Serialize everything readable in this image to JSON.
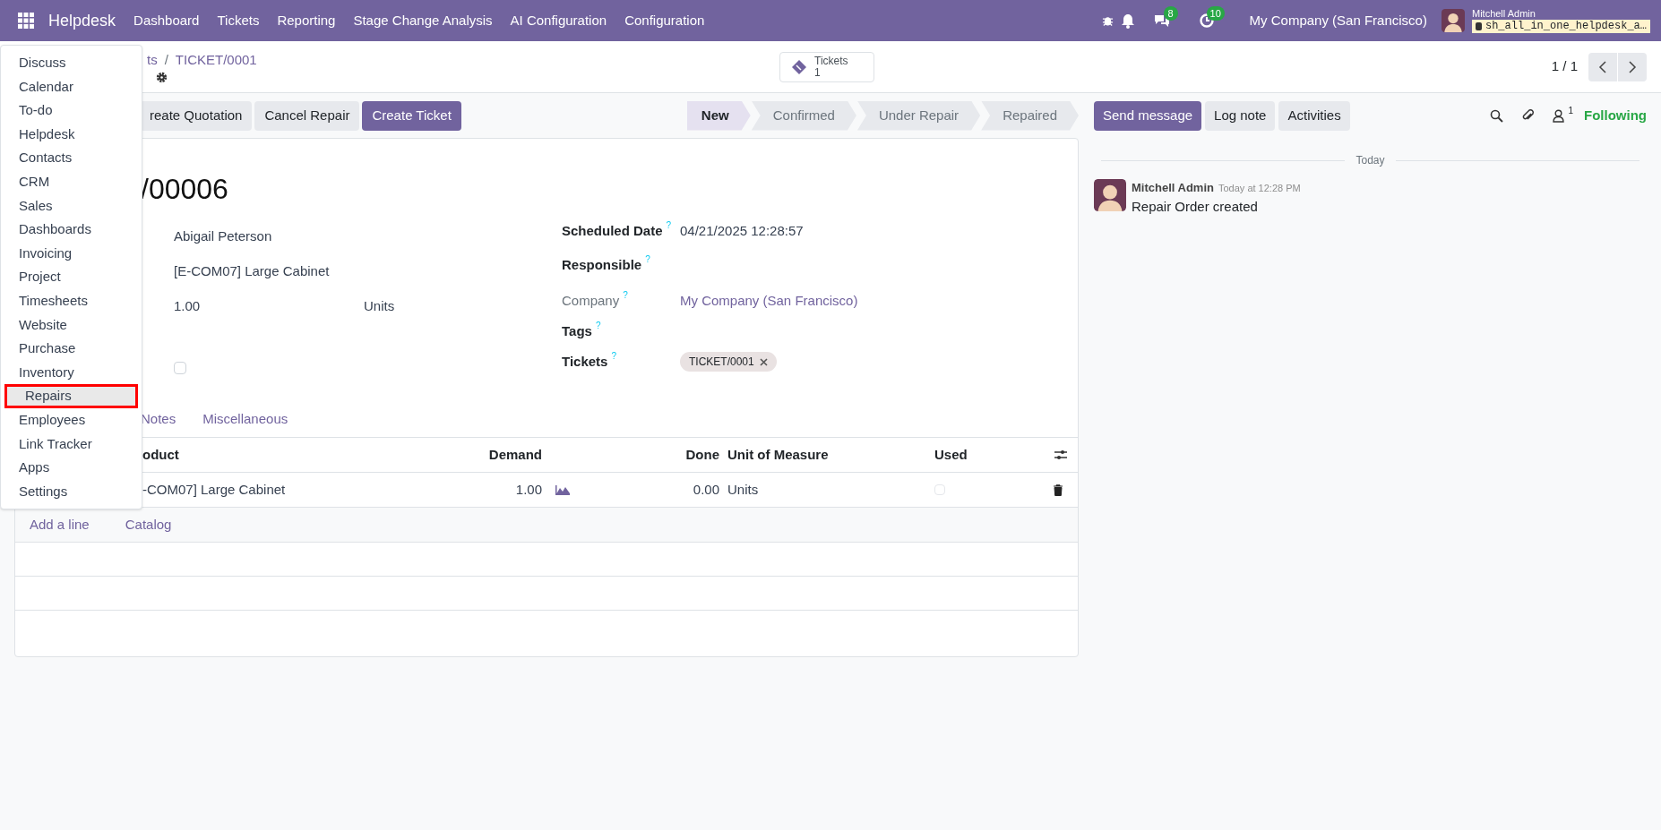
{
  "navbar": {
    "app_name": "Helpdesk",
    "menu": [
      "Dashboard",
      "Tickets",
      "Reporting",
      "Stage Change Analysis",
      "AI Configuration",
      "Configuration"
    ],
    "chat_badge": "8",
    "activity_badge": "10",
    "company": "My Company (San Francisco)",
    "user_name": "Mitchell Admin",
    "database": "sh_all_in_one_helpdesk_a…"
  },
  "breadcrumb": {
    "items": [
      "ts",
      "TICKET/0001"
    ],
    "separator": "/"
  },
  "smart_button": {
    "label": "Tickets",
    "count": "1"
  },
  "pager": "1 / 1",
  "actions": [
    {
      "label": "reate Quotation",
      "kind": "secondary"
    },
    {
      "label": "Cancel Repair",
      "kind": "secondary"
    },
    {
      "label": "Create Ticket",
      "kind": "primary"
    }
  ],
  "stages": [
    {
      "label": "New",
      "selected": true
    },
    {
      "label": "Confirmed",
      "selected": false
    },
    {
      "label": "Under Repair",
      "selected": false
    },
    {
      "label": "Repaired",
      "selected": false
    }
  ],
  "chatter": {
    "buttons": [
      {
        "label": "Send message",
        "kind": "primary"
      },
      {
        "label": "Log note",
        "kind": "secondary"
      },
      {
        "label": "Activities",
        "kind": "secondary"
      }
    ],
    "follower_count": "1",
    "following": "Following",
    "separator": "Today",
    "messages": [
      {
        "author": "Mitchell Admin",
        "time": "Today at 12:28 PM",
        "body": "Repair Order created"
      }
    ]
  },
  "record": {
    "title": "/00006",
    "customer": "Abigail Peterson",
    "product": "[E-COM07] Large Cabinet",
    "quantity": "1.00",
    "uom": "Units",
    "checkbox": {
      "checked": false
    },
    "right_fields": [
      {
        "label": "Scheduled Date",
        "help": "?",
        "value": "04/21/2025 12:28:57",
        "kind": "text",
        "readonly": false
      },
      {
        "label": "Responsible",
        "help": "?",
        "kind": "text",
        "readonly": false
      },
      {
        "label": "Company",
        "help": "?",
        "value": "My Company (San Francisco)",
        "kind": "link",
        "readonly": true
      },
      {
        "label": "Tags",
        "help": "?",
        "kind": "tags",
        "readonly": false
      },
      {
        "label": "Tickets",
        "help": "?",
        "kind": "tags",
        "tags": [
          "TICKET/0001"
        ],
        "readonly": false
      }
    ]
  },
  "tabs": [
    {
      "label": "Notes",
      "selected": false
    },
    {
      "label": "Miscellaneous",
      "selected": false
    }
  ],
  "table": {
    "columns": [
      "oduct",
      "Demand",
      "Done",
      "Unit of Measure",
      "Used"
    ],
    "rows": [
      {
        "product": "-COM07] Large Cabinet",
        "demand": "1.00",
        "done": "0.00",
        "uom": "Units",
        "used": false
      }
    ],
    "add_links": [
      "Add a line",
      "Catalog"
    ]
  },
  "app_menu": [
    {
      "label": "Discuss",
      "selected": false
    },
    {
      "label": "Calendar",
      "selected": false
    },
    {
      "label": "To-do",
      "selected": false
    },
    {
      "label": "Helpdesk",
      "selected": false
    },
    {
      "label": "Contacts",
      "selected": false
    },
    {
      "label": "CRM",
      "selected": false
    },
    {
      "label": "Sales",
      "selected": false
    },
    {
      "label": "Dashboards",
      "selected": false
    },
    {
      "label": "Invoicing",
      "selected": false
    },
    {
      "label": "Project",
      "selected": false
    },
    {
      "label": "Timesheets",
      "selected": false
    },
    {
      "label": "Website",
      "selected": false
    },
    {
      "label": "Purchase",
      "selected": false
    },
    {
      "label": "Inventory",
      "selected": false
    },
    {
      "label": "Repairs",
      "selected": true
    },
    {
      "label": "Employees",
      "selected": false
    },
    {
      "label": "Link Tracker",
      "selected": false
    },
    {
      "label": "Apps",
      "selected": false
    },
    {
      "label": "Settings",
      "selected": false
    }
  ]
}
